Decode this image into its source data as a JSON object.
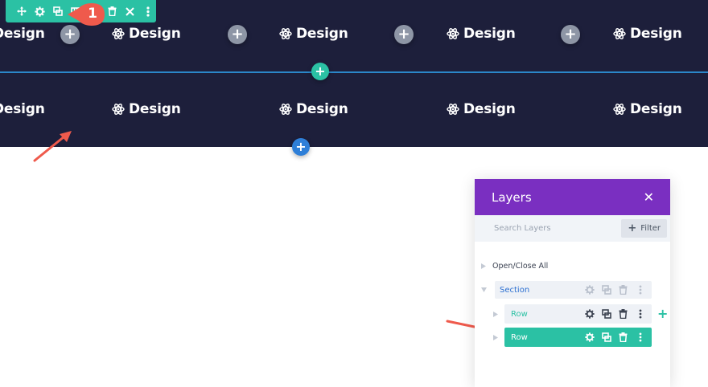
{
  "hero": {
    "module_label": "Design",
    "top_row_items": [
      "Design",
      "Design",
      "Design",
      "Design",
      "Design"
    ],
    "bottom_row_items": [
      "Design",
      "Design",
      "Design",
      "Design",
      "Design"
    ],
    "plus_symbol": "+"
  },
  "toolbar": {
    "badge_number": "1",
    "icons": [
      "move-icon",
      "gear-icon",
      "duplicate-icon",
      "columns-icon",
      "trash-icon",
      "close-icon",
      "more-icon"
    ]
  },
  "layers": {
    "title": "Layers",
    "close_symbol": "✕",
    "search_placeholder": "Search Layers",
    "filter_label": "Filter",
    "open_close_label": "Open/Close All",
    "section_label": "Section",
    "rows": [
      {
        "label": "Row",
        "active": false
      },
      {
        "label": "Row",
        "active": true
      }
    ],
    "add_symbol": "+"
  },
  "colors": {
    "hero_bg": "#1d1f3b",
    "teal": "#2bc1a4",
    "blue": "#2e7fd8",
    "purple": "#7a2fc1",
    "badge_red": "#ef5a4c",
    "divider": "#2b87c9"
  }
}
